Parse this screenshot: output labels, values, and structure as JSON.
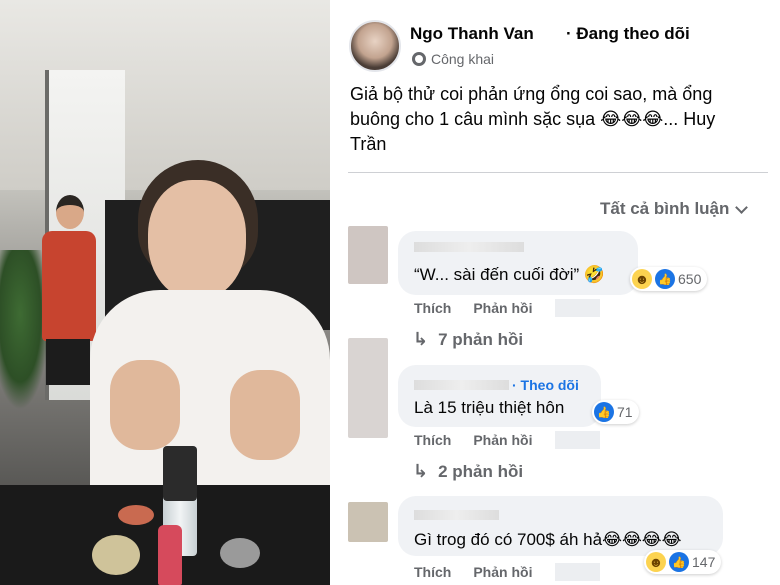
{
  "post": {
    "author": "Ngo Thanh Van",
    "follow_label": "· Đang theo dõi",
    "privacy": "Công khai",
    "caption": "Giả bộ thử coi phản ứng ổng coi sao, mà ổng buông cho 1 câu mình sặc sụa 😂😂😂... Huy Trần",
    "sort_label": "Tất cả bình luận"
  },
  "comments": [
    {
      "text": "“W... sài đến cuối đời” 🤣",
      "reaction_count": "650",
      "like_label": "Thích",
      "reply_label": "Phản hồi",
      "replies_label": "7 phản hồi"
    },
    {
      "follow_label": "· Theo dõi",
      "text": "Là 15 triệu thiệt hôn",
      "reaction_count": "71",
      "like_label": "Thích",
      "reply_label": "Phản hồi",
      "replies_label": "2 phản hồi"
    },
    {
      "text": "Gì trog đó có 700$ áh hả😂😂😂😂",
      "reaction_count": "147",
      "like_label": "Thích",
      "reply_label": "Phản hồi"
    }
  ],
  "colors": {
    "link_blue": "#1b74e4",
    "bubble_bg": "#f0f2f5",
    "secondary_text": "#65676b"
  }
}
